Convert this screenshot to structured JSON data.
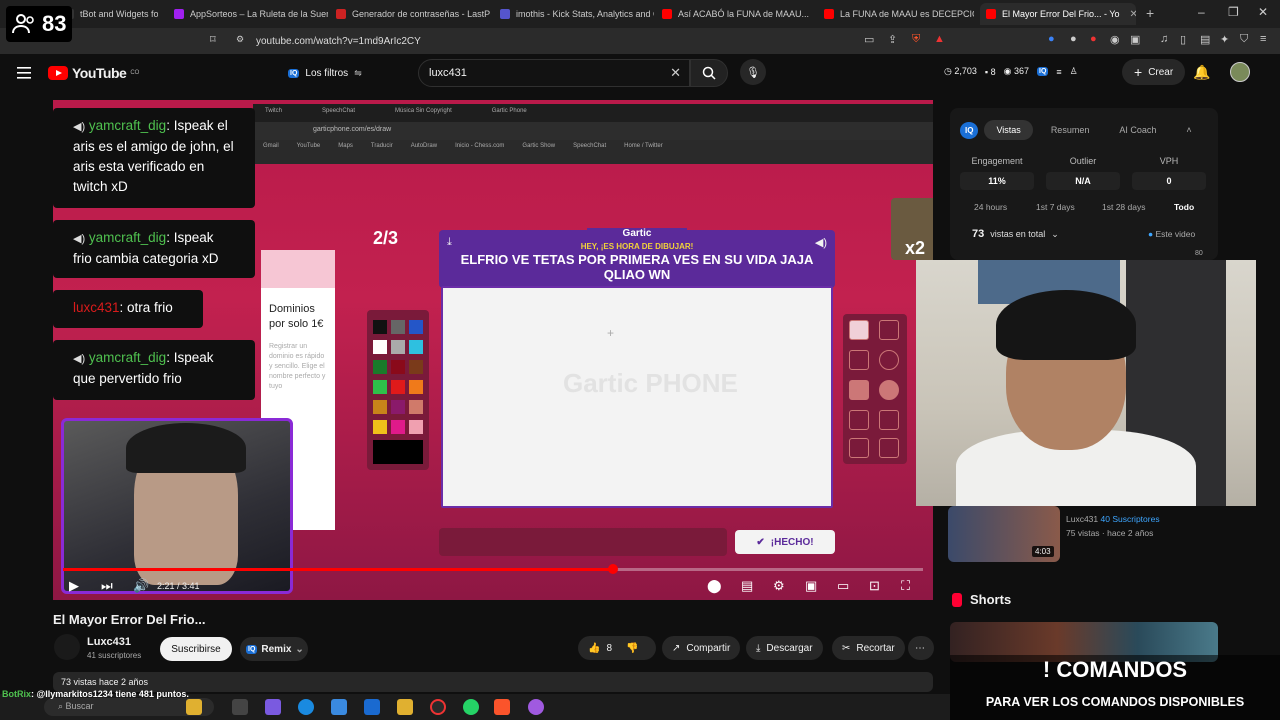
{
  "browser": {
    "tabs": [
      {
        "label": "tBot and Widgets for Ki",
        "color": "#333333"
      },
      {
        "label": "AppSorteos – La Ruleta de la Suerte",
        "color": "#a020f0"
      },
      {
        "label": "Generador de contraseñas - LastPass",
        "color": "#cc2222"
      },
      {
        "label": "imothis - Kick Stats, Analytics and Ch",
        "color": "#5555cc"
      },
      {
        "label": "Así ACABÓ la FUNA de MAAU... | On",
        "color": "#ff0000"
      },
      {
        "label": "La FUNA de MAAU es DECEPCIONAN",
        "color": "#ff0000"
      },
      {
        "label": "El Mayor Error Del Frio... - Yo",
        "color": "#ff0000"
      }
    ],
    "url": "youtube.com/watch?v=1md9ArIc2CY"
  },
  "viewer_count": "83",
  "header": {
    "logo_text": "YouTube",
    "logo_country": "CO",
    "filters_label": "Los filtros",
    "search_value": "luxc431",
    "stats": [
      "2,703",
      "8",
      "367"
    ],
    "create_label": "Crear"
  },
  "player": {
    "chat": [
      {
        "user": "yamcraft_dig",
        "text": ": Ispeak el aris es el amigo de john, el aris esta verificado en twitch xD",
        "voice": true
      },
      {
        "user": "yamcraft_dig",
        "text": ": Ispeak frio cambia categoria xD",
        "voice": true
      },
      {
        "user": "luxc431",
        "text": ": otra frio",
        "voice": false
      },
      {
        "user": "yamcraft_dig",
        "text": ": Ispeak que pervertido frio",
        "voice": true
      }
    ],
    "round": "2/3",
    "game_logo": "Gartic",
    "draw_hint": "HEY, ¡ES HORA DE DIBUJAR!",
    "draw_prompt": "ELFRIO VE TETAS POR PRIMERA VES EN SU VIDA JAJA QLIAO WN",
    "canvas_watermark": "Gartic PHONE",
    "done_label": "¡HECHO!",
    "multiplier": "x2",
    "ad_title": "Dominios por solo 1€",
    "ad_body": "Registrar un dominio es rápido y sencillo. Elige el nombre perfecto y tuyo",
    "inner_url": "garticphone.com/es/draw",
    "time_current": "2:21",
    "time_total": "3:41",
    "progress": 0.64
  },
  "extension": {
    "tabs": [
      "Vistas",
      "Resumen",
      "AI Coach"
    ],
    "active_tab": "Vistas",
    "metrics": [
      {
        "label": "Engagement",
        "value": "11%"
      },
      {
        "label": "Outlier",
        "value": "N/A"
      },
      {
        "label": "VPH",
        "value": "0"
      }
    ],
    "ranges": [
      "24 hours",
      "1st 7 days",
      "1st 28 days",
      "Todo"
    ],
    "active_range": "Todo",
    "total_views": "73",
    "total_label": "vistas en total",
    "este_label": "Este video",
    "chart_top": "80"
  },
  "video": {
    "title": "El Mayor Error Del Frio...",
    "channel": "Luxc431",
    "subscribers": "41 suscriptores",
    "subscribe_label": "Suscribirse",
    "remix_label": "Remix",
    "likes": "8",
    "share_label": "Compartir",
    "download_label": "Descargar",
    "clip_label": "Recortar",
    "description": "73 vistas  hace 2 años"
  },
  "recommended": {
    "channel": "Luxc431",
    "subs_badge": "40 Suscriptores",
    "meta": "75 vistas · hace 2 años",
    "duration": "4:03"
  },
  "shorts_label": "Shorts",
  "overlay": {
    "commands_title": "! COMANDOS",
    "commands_sub": "PARA VER LOS COMANDOS DISPONIBLES",
    "bot_name": "BotRix",
    "bot_text": ": @llymarkitos1234 tiene 481 puntos."
  },
  "taskbar": {
    "search_placeholder": "Buscar"
  }
}
